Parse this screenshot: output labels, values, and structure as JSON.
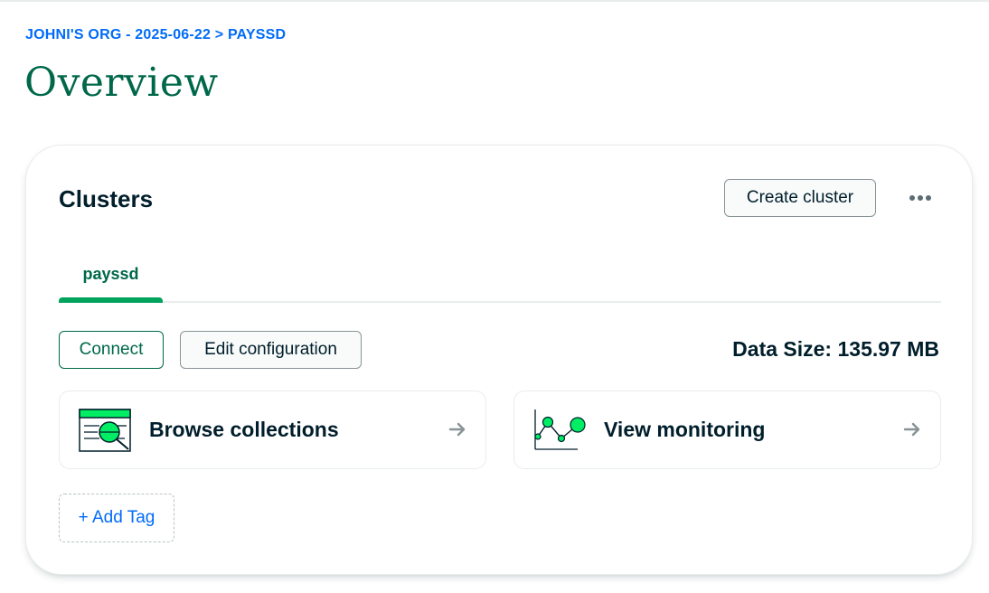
{
  "breadcrumb": "JOHNI'S ORG - 2025-06-22 > PAYSSD",
  "page_title": "Overview",
  "clusters": {
    "title": "Clusters",
    "create_button": "Create cluster",
    "more_icon": "ellipsis-icon",
    "tabs": [
      {
        "label": "payssd",
        "active": true
      }
    ],
    "connect_button": "Connect",
    "edit_button": "Edit configuration",
    "data_size": "Data Size: 135.97 MB",
    "tiles": [
      {
        "label": "Browse collections",
        "icon": "browse-collections-illustration",
        "arrow": "arrow-right-icon"
      },
      {
        "label": "View monitoring",
        "icon": "monitoring-chart-illustration",
        "arrow": "arrow-right-icon"
      }
    ],
    "add_tag": "+ Add Tag"
  },
  "colors": {
    "brand_green": "#00684a",
    "accent_green": "#00ed64",
    "tab_underline": "#00a35c",
    "link_blue": "#016bf8",
    "text_dark": "#001e2b"
  }
}
